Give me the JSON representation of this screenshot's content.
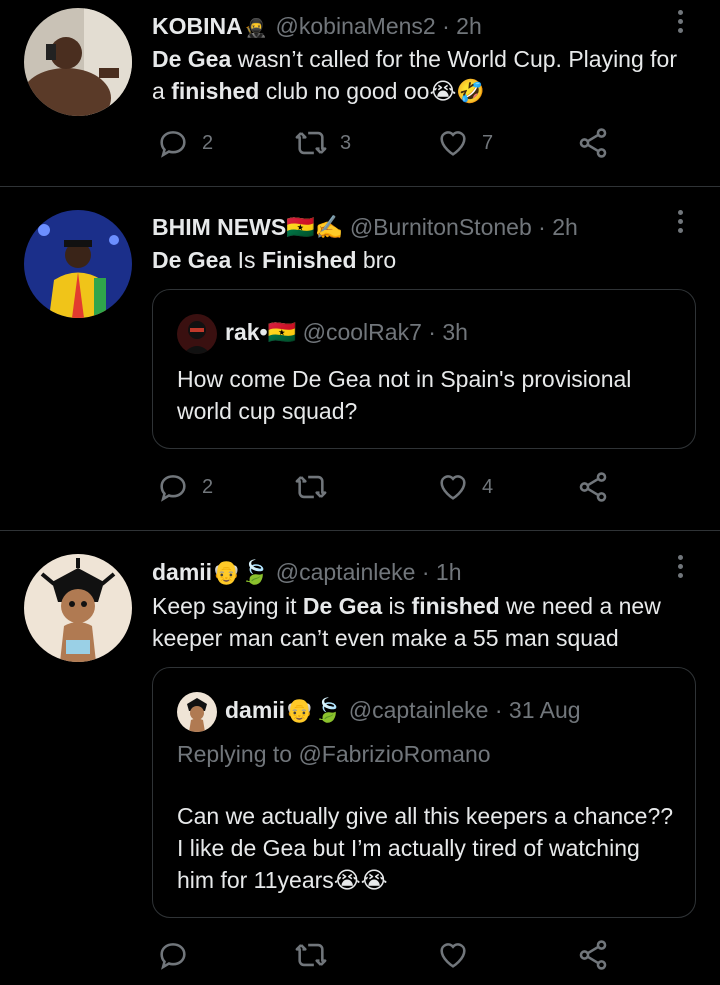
{
  "tweets": [
    {
      "name": "KOBINA",
      "handle": "@kobinaMens2",
      "dot": "·",
      "time": "2h",
      "text_parts": [
        "De Gea",
        " wasn’t called for the World Cup. Playing for a ",
        "finished",
        " club no good oo😭🤣"
      ],
      "replies": "2",
      "retweets": "3",
      "likes": "7"
    },
    {
      "name": "BHIM NEWS🇬🇭✍️",
      "handle": "@BurnitonStoneb",
      "dot": "·",
      "time": "2h",
      "text_parts": [
        "De Gea",
        " Is ",
        "Finished",
        " bro"
      ],
      "quote": {
        "name": "rak•🇬🇭",
        "handle": "@coolRak7",
        "dot": "·",
        "time": "3h",
        "text": "How come De Gea not in Spain's provisional world cup squad?"
      },
      "replies": "2",
      "retweets": "",
      "likes": "4"
    },
    {
      "name": "damii👴🍃",
      "handle": "@captainleke",
      "dot": "·",
      "time": "1h",
      "text_parts": [
        "Keep saying it ",
        "De Gea",
        " is ",
        "finished",
        " we need a new keeper man can’t even make a 55 man squad"
      ],
      "quote": {
        "name": "damii👴🍃",
        "handle": "@captainleke",
        "dot": "·",
        "time": "31 Aug",
        "replying": "Replying to @FabrizioRomano",
        "text": "Can we actually give all this keepers a chance?? I like de Gea but I’m actually tired of watching him for 11years😭😭"
      },
      "replies": "",
      "retweets": "",
      "likes": ""
    }
  ],
  "colors": {
    "background": "#000000",
    "text": "#e7e9ea",
    "muted": "#71767b",
    "divider": "#2f3336"
  }
}
